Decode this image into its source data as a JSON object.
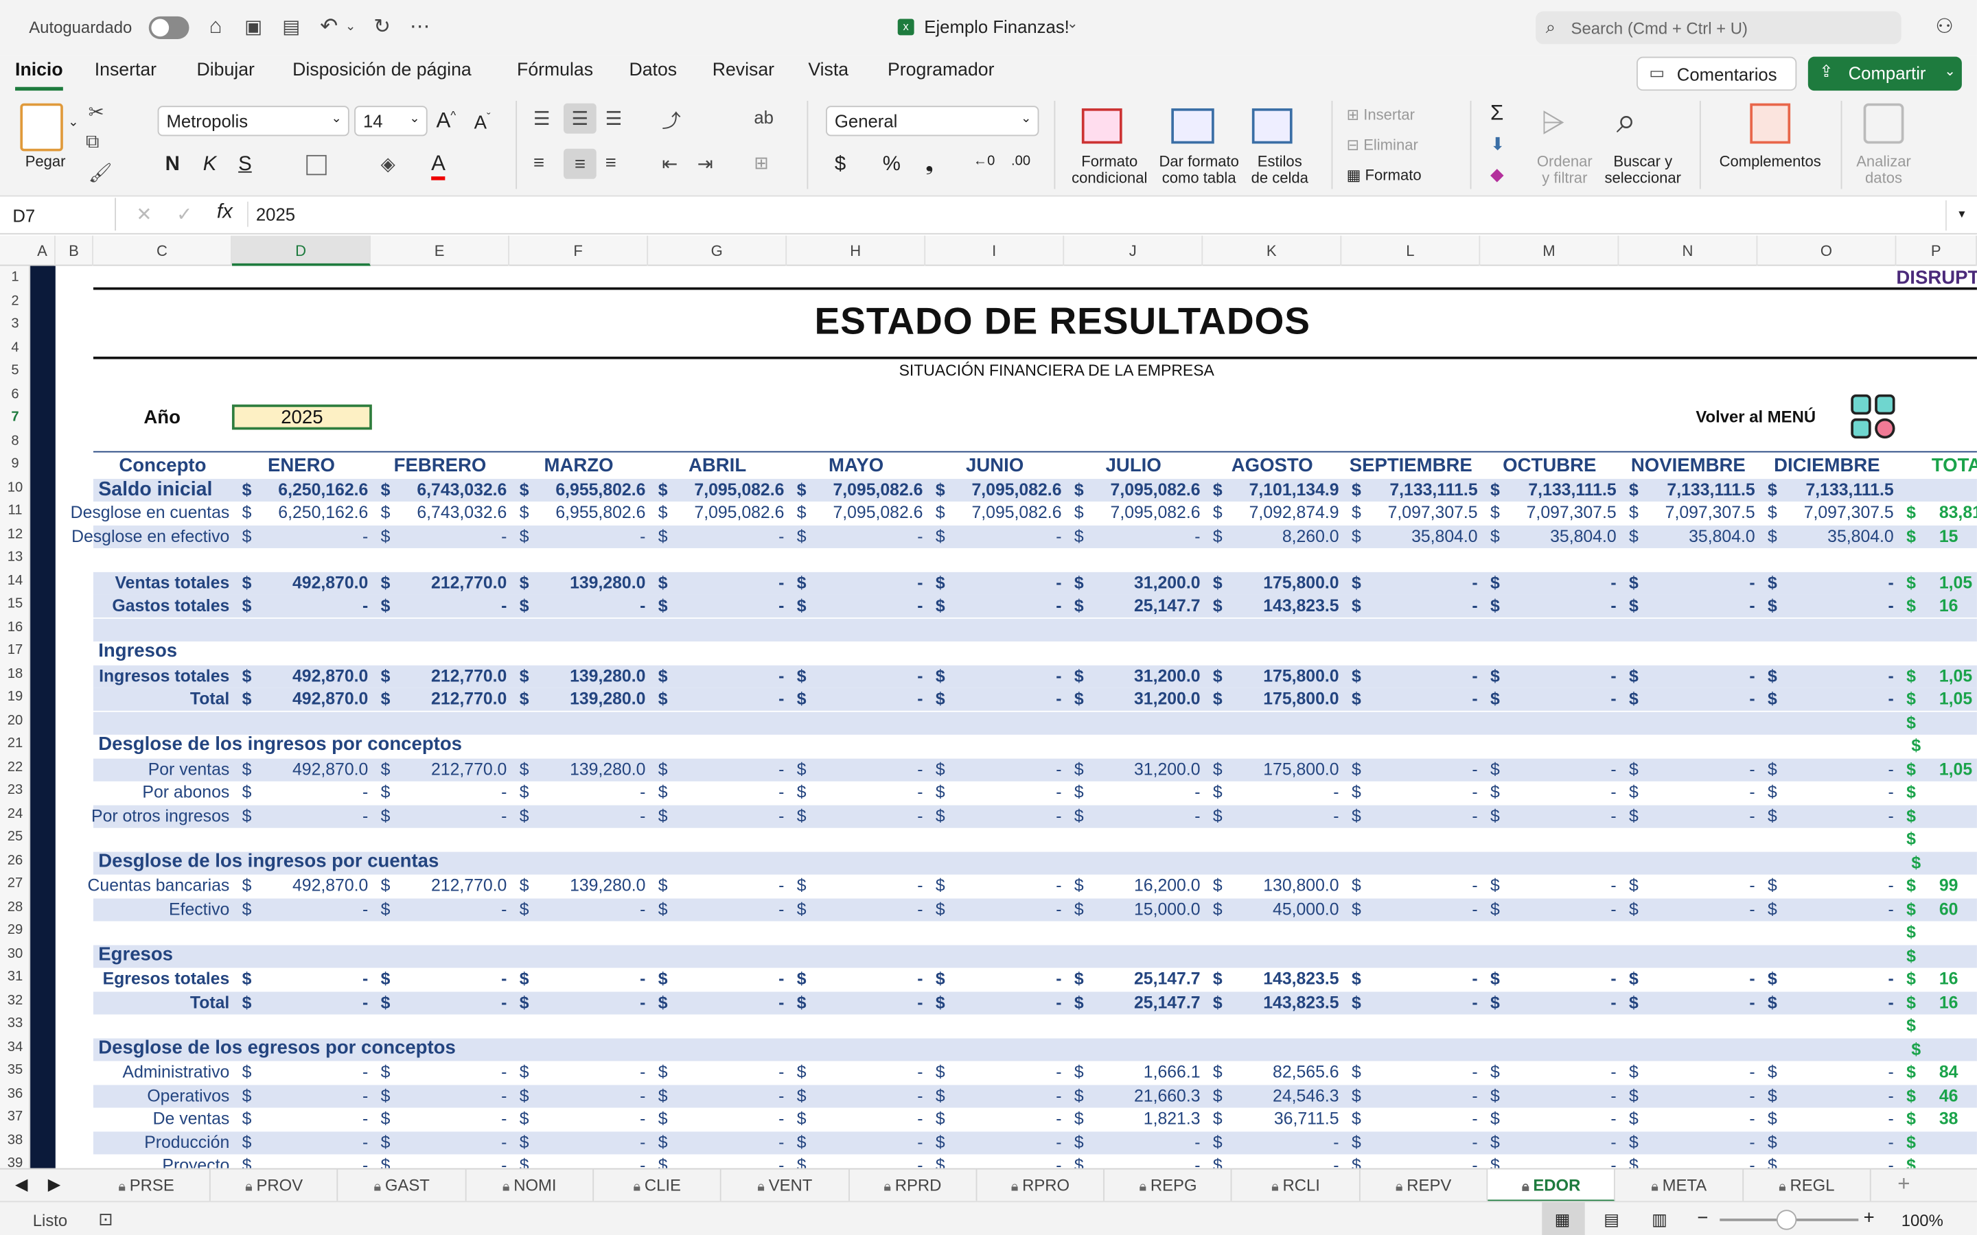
{
  "titlebar": {
    "autosave": "Autoguardado",
    "doc_title": "Ejemplo Finanzas!",
    "search_placeholder": "Search (Cmd + Ctrl + U)"
  },
  "menu": {
    "items": [
      "Inicio",
      "Insertar",
      "Dibujar",
      "Disposición de página",
      "Fórmulas",
      "Datos",
      "Revisar",
      "Vista",
      "Programador"
    ],
    "comments": "Comentarios",
    "share": "Compartir"
  },
  "ribbon": {
    "paste": "Pegar",
    "font": "Metropolis",
    "size": "14",
    "number_format": "General",
    "cond_format": [
      "Formato",
      "condicional"
    ],
    "table_format": [
      "Dar formato",
      "como tabla"
    ],
    "cell_styles": [
      "Estilos",
      "de celda"
    ],
    "insert": "Insertar",
    "delete": "Eliminar",
    "format": "Formato",
    "sort": [
      "Ordenar",
      "y filtrar"
    ],
    "find": [
      "Buscar y",
      "seleccionar"
    ],
    "addins": "Complementos",
    "analyze": [
      "Analizar",
      "datos"
    ],
    "bold": "N",
    "italic": "K",
    "underline": "S"
  },
  "formula_bar": {
    "name_box": "D7",
    "formula": "2025"
  },
  "columns": [
    "A",
    "B",
    "C",
    "D",
    "E",
    "F",
    "G",
    "H",
    "I",
    "J",
    "K",
    "L",
    "M",
    "N",
    "O",
    "P"
  ],
  "sheet": {
    "brand": "DISRUPT",
    "title": "ESTADO DE RESULTADOS",
    "subtitle": "SITUACIÓN FINANCIERA DE LA EMPRESA",
    "year_label": "Año",
    "year": "2025",
    "back": "Volver al MENÚ",
    "months": [
      "Concepto",
      "ENERO",
      "FEBRERO",
      "MARZO",
      "ABRIL",
      "MAYO",
      "JUNIO",
      "JULIO",
      "AGOSTO",
      "SEPTIEMBRE",
      "OCTUBRE",
      "NOVIEMBRE",
      "DICIEMBRE",
      "TOTA"
    ],
    "rows": [
      {
        "r": 10,
        "label": "Saldo inicial",
        "bold": true,
        "big": true,
        "left": true,
        "vals": [
          "6,250,162.6",
          "6,743,032.6",
          "6,955,802.6",
          "7,095,082.6",
          "7,095,082.6",
          "7,095,082.6",
          "7,095,082.6",
          "7,101,134.9",
          "7,133,111.5",
          "7,133,111.5",
          "7,133,111.5",
          "7,133,111.5"
        ],
        "total": ""
      },
      {
        "r": 11,
        "label": "Desglose en cuentas",
        "vals": [
          "6,250,162.6",
          "6,743,032.6",
          "6,955,802.6",
          "7,095,082.6",
          "7,095,082.6",
          "7,095,082.6",
          "7,095,082.6",
          "7,092,874.9",
          "7,097,307.5",
          "7,097,307.5",
          "7,097,307.5",
          "7,097,307.5"
        ],
        "total": "83,81"
      },
      {
        "r": 12,
        "label": "Desglose en efectivo",
        "vals": [
          "-",
          "-",
          "-",
          "-",
          "-",
          "-",
          "-",
          "8,260.0",
          "35,804.0",
          "35,804.0",
          "35,804.0",
          "35,804.0"
        ],
        "total": "15"
      },
      {
        "r": 14,
        "label": "Ventas totales",
        "bold": true,
        "vals": [
          "492,870.0",
          "212,770.0",
          "139,280.0",
          "-",
          "-",
          "-",
          "31,200.0",
          "175,800.0",
          "-",
          "-",
          "-",
          "-"
        ],
        "total": "1,05"
      },
      {
        "r": 15,
        "label": "Gastos totales",
        "bold": true,
        "vals": [
          "-",
          "-",
          "-",
          "-",
          "-",
          "-",
          "25,147.7",
          "143,823.5",
          "-",
          "-",
          "-",
          "-"
        ],
        "total": "16"
      },
      {
        "r": 18,
        "label": "Ingresos totales",
        "bold": true,
        "vals": [
          "492,870.0",
          "212,770.0",
          "139,280.0",
          "-",
          "-",
          "-",
          "31,200.0",
          "175,800.0",
          "-",
          "-",
          "-",
          "-"
        ],
        "total": "1,05"
      },
      {
        "r": 19,
        "label": "Total",
        "bold": true,
        "vals": [
          "492,870.0",
          "212,770.0",
          "139,280.0",
          "-",
          "-",
          "-",
          "31,200.0",
          "175,800.0",
          "-",
          "-",
          "-",
          "-"
        ],
        "total": "1,05"
      },
      {
        "r": 22,
        "label": "Por ventas",
        "vals": [
          "492,870.0",
          "212,770.0",
          "139,280.0",
          "-",
          "-",
          "-",
          "31,200.0",
          "175,800.0",
          "-",
          "-",
          "-",
          "-"
        ],
        "total": "1,05"
      },
      {
        "r": 23,
        "label": "Por abonos",
        "vals": [
          "-",
          "-",
          "-",
          "-",
          "-",
          "-",
          "-",
          "-",
          "-",
          "-",
          "-",
          "-"
        ],
        "total": ""
      },
      {
        "r": 24,
        "label": "Por otros ingresos",
        "vals": [
          "-",
          "-",
          "-",
          "-",
          "-",
          "-",
          "-",
          "-",
          "-",
          "-",
          "-",
          "-"
        ],
        "total": ""
      },
      {
        "r": 27,
        "label": "Cuentas bancarias",
        "vals": [
          "492,870.0",
          "212,770.0",
          "139,280.0",
          "-",
          "-",
          "-",
          "16,200.0",
          "130,800.0",
          "-",
          "-",
          "-",
          "-"
        ],
        "total": "99"
      },
      {
        "r": 28,
        "label": "Efectivo",
        "vals": [
          "-",
          "-",
          "-",
          "-",
          "-",
          "-",
          "15,000.0",
          "45,000.0",
          "-",
          "-",
          "-",
          "-"
        ],
        "total": "60"
      },
      {
        "r": 31,
        "label": "Egresos totales",
        "bold": true,
        "vals": [
          "-",
          "-",
          "-",
          "-",
          "-",
          "-",
          "25,147.7",
          "143,823.5",
          "-",
          "-",
          "-",
          "-"
        ],
        "total": "16"
      },
      {
        "r": 32,
        "label": "Total",
        "bold": true,
        "vals": [
          "-",
          "-",
          "-",
          "-",
          "-",
          "-",
          "25,147.7",
          "143,823.5",
          "-",
          "-",
          "-",
          "-"
        ],
        "total": "16"
      },
      {
        "r": 35,
        "label": "Administrativo",
        "vals": [
          "-",
          "-",
          "-",
          "-",
          "-",
          "-",
          "1,666.1",
          "82,565.6",
          "-",
          "-",
          "-",
          "-"
        ],
        "total": "84"
      },
      {
        "r": 36,
        "label": "Operativos",
        "vals": [
          "-",
          "-",
          "-",
          "-",
          "-",
          "-",
          "21,660.3",
          "24,546.3",
          "-",
          "-",
          "-",
          "-"
        ],
        "total": "46"
      },
      {
        "r": 37,
        "label": "De ventas",
        "vals": [
          "-",
          "-",
          "-",
          "-",
          "-",
          "-",
          "1,821.3",
          "36,711.5",
          "-",
          "-",
          "-",
          "-"
        ],
        "total": "38"
      },
      {
        "r": 38,
        "label": "Producción",
        "vals": [
          "-",
          "-",
          "-",
          "-",
          "-",
          "-",
          "-",
          "-",
          "-",
          "-",
          "-",
          "-"
        ],
        "total": ""
      },
      {
        "r": 39,
        "label": "Proyecto",
        "vals": [
          "-",
          "-",
          "-",
          "-",
          "-",
          "-",
          "-",
          "-",
          "-",
          "-",
          "-",
          "-"
        ],
        "total": ""
      }
    ],
    "headings": [
      {
        "r": 17,
        "text": "Ingresos"
      },
      {
        "r": 21,
        "text": "Desglose de los ingresos por conceptos"
      },
      {
        "r": 26,
        "text": "Desglose de los ingresos por cuentas"
      },
      {
        "r": 30,
        "text": "Egresos"
      },
      {
        "r": 34,
        "text": "Desglose de los egresos por conceptos"
      }
    ],
    "dollar_only_rows": [
      20,
      21,
      25,
      26,
      29,
      30,
      33,
      34
    ]
  },
  "tabs": [
    "PRSE",
    "PROV",
    "GAST",
    "NOMI",
    "CLIE",
    "VENT",
    "RPRD",
    "RPRO",
    "REPG",
    "RCLI",
    "REPV",
    "EDOR",
    "META",
    "REGL"
  ],
  "active_tab": "EDOR",
  "status": {
    "ready": "Listo",
    "zoom": "100%"
  },
  "colors": {
    "accent_green": "#1e7b3e",
    "text_blue": "#23447f",
    "band": "#dce3f3",
    "total_green": "#1aa34a"
  }
}
